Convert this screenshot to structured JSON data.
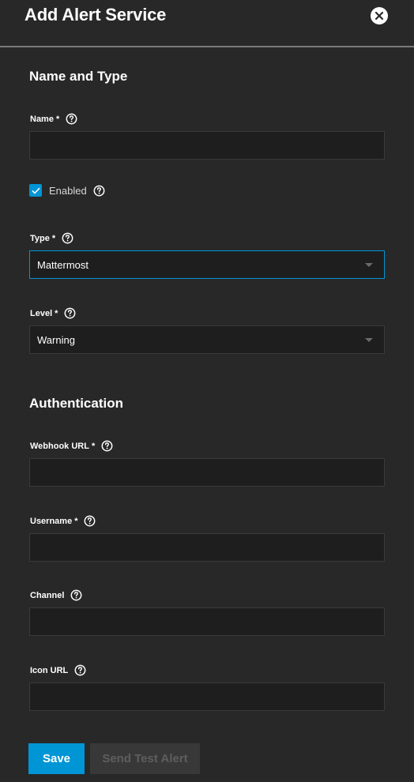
{
  "header": {
    "title": "Add Alert Service"
  },
  "sections": {
    "name_type": "Name and Type",
    "authentication": "Authentication"
  },
  "fields": {
    "name": {
      "label": "Name",
      "required": "*",
      "value": ""
    },
    "enabled": {
      "label": "Enabled",
      "checked": true
    },
    "type": {
      "label": "Type",
      "required": "*",
      "value": "Mattermost"
    },
    "level": {
      "label": "Level",
      "required": "*",
      "value": "Warning"
    },
    "webhook_url": {
      "label": "Webhook URL",
      "required": "*",
      "value": ""
    },
    "username": {
      "label": "Username",
      "required": "*",
      "value": ""
    },
    "channel": {
      "label": "Channel",
      "value": ""
    },
    "icon_url": {
      "label": "Icon URL",
      "value": ""
    }
  },
  "actions": {
    "save": "Save",
    "send_test": "Send Test Alert"
  },
  "colors": {
    "background": "#282828",
    "input_bg": "#1e1e1e",
    "accent": "#0095d5",
    "disabled_button_bg": "#383838",
    "disabled_text": "#5e5e5e"
  }
}
